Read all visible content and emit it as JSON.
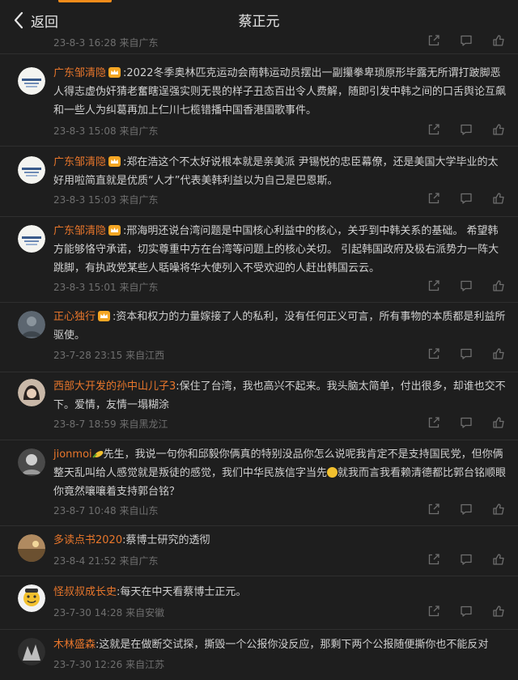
{
  "header": {
    "back_label": "返回",
    "title": "蔡正元"
  },
  "partial": {
    "time": "23-8-3 16:28",
    "location": "来自广东"
  },
  "comments": [
    {
      "name": "广东邹清隐",
      "text": ":2022冬季奥林匹克运动会南韩运动员摆出一副攥拳卑琐原形毕露无所谓打跛脚恶人得志虚伪奸猜老奮瞎逞强实则无畏的样子丑态百出令人费解，随即引发中韩之间的口舌舆论互飙和一些人为纠葛再加上仁川七榄错播中国香港国歌事件。",
      "time": "23-8-3 15:08",
      "location": "来自广东"
    },
    {
      "name": "广东邹清隐",
      "text": ":郑在浩这个不太好说根本就是亲美派 尹锡悦的忠臣幕僚，还是美国大学毕业的太好用啦简直就是优质“人才”代表美韩利益以为自己是巴恩斯。",
      "time": "23-8-3 15:03",
      "location": "来自广东"
    },
    {
      "name": "广东邹清隐",
      "text": ":邢海明还说台湾问题是中国核心利益中的核心，关乎到中韩关系的基础。 希望韩方能够恪守承诺，切实尊重中方在台湾等问题上的核心关切。 引起韩国政府及极右派势力一阵大跳脚，有执政党某些人聒噪将华大使列入不受欢迎的人赶出韩国云云。",
      "time": "23-8-3 15:01",
      "location": "来自广东"
    },
    {
      "name": "正心独行",
      "text": ":资本和权力的力量嫁接了人的私利，没有任何正义可言，所有事物的本质都是利益所驱使。",
      "time": "23-7-28 23:15",
      "location": "来自江西"
    },
    {
      "name": "西部大开发的孙中山儿子3",
      "text": ":保住了台湾，我也高兴不起来。我头脑太简单，付出很多，却谁也交不下。爱情，友情一塌糊涂",
      "time": "23-8-7 18:59",
      "location": "来自黑龙江"
    },
    {
      "name": "jionmoi",
      "text_a": "先生，我说一句你和邱毅你俩真的特别没品你怎么说呢我肯定不是支持国民党，但你俩整天乱叫给人感觉就是叛徒的感觉，我们中华民族信字当先",
      "text_b": "就我而言我看赖清德都比郭台铭顺眼你竟然嚷嚷着支持郭台铭？",
      "time": "23-8-7 10:48",
      "location": "来自山东"
    },
    {
      "name": "多读点书2020",
      "text": ":蔡博士研究的透彻",
      "time": "23-8-4 21:52",
      "location": "来自广东"
    },
    {
      "name": "怪叔叔成长史",
      "text": ":每天在中天看蔡博士正元。",
      "time": "23-7-30 14:28",
      "location": "来自安徽"
    },
    {
      "name": "木林盛森",
      "text": ":这就是在做断交试探，撕毁一个公报你没反应，那剩下两个公报随便撕你也不能反对",
      "time": "23-7-30 12:26",
      "location": "来自江苏"
    }
  ],
  "icons": {
    "back": "chevron-left-icon",
    "share": "share-icon",
    "reply": "comment-icon",
    "like": "thumbs-up-icon",
    "vip": "vip-crown-icon"
  },
  "colors": {
    "background": "#1e1e1e",
    "name": "#e8762b",
    "meta": "#6f6f6f",
    "accent": "#f28c1a"
  }
}
